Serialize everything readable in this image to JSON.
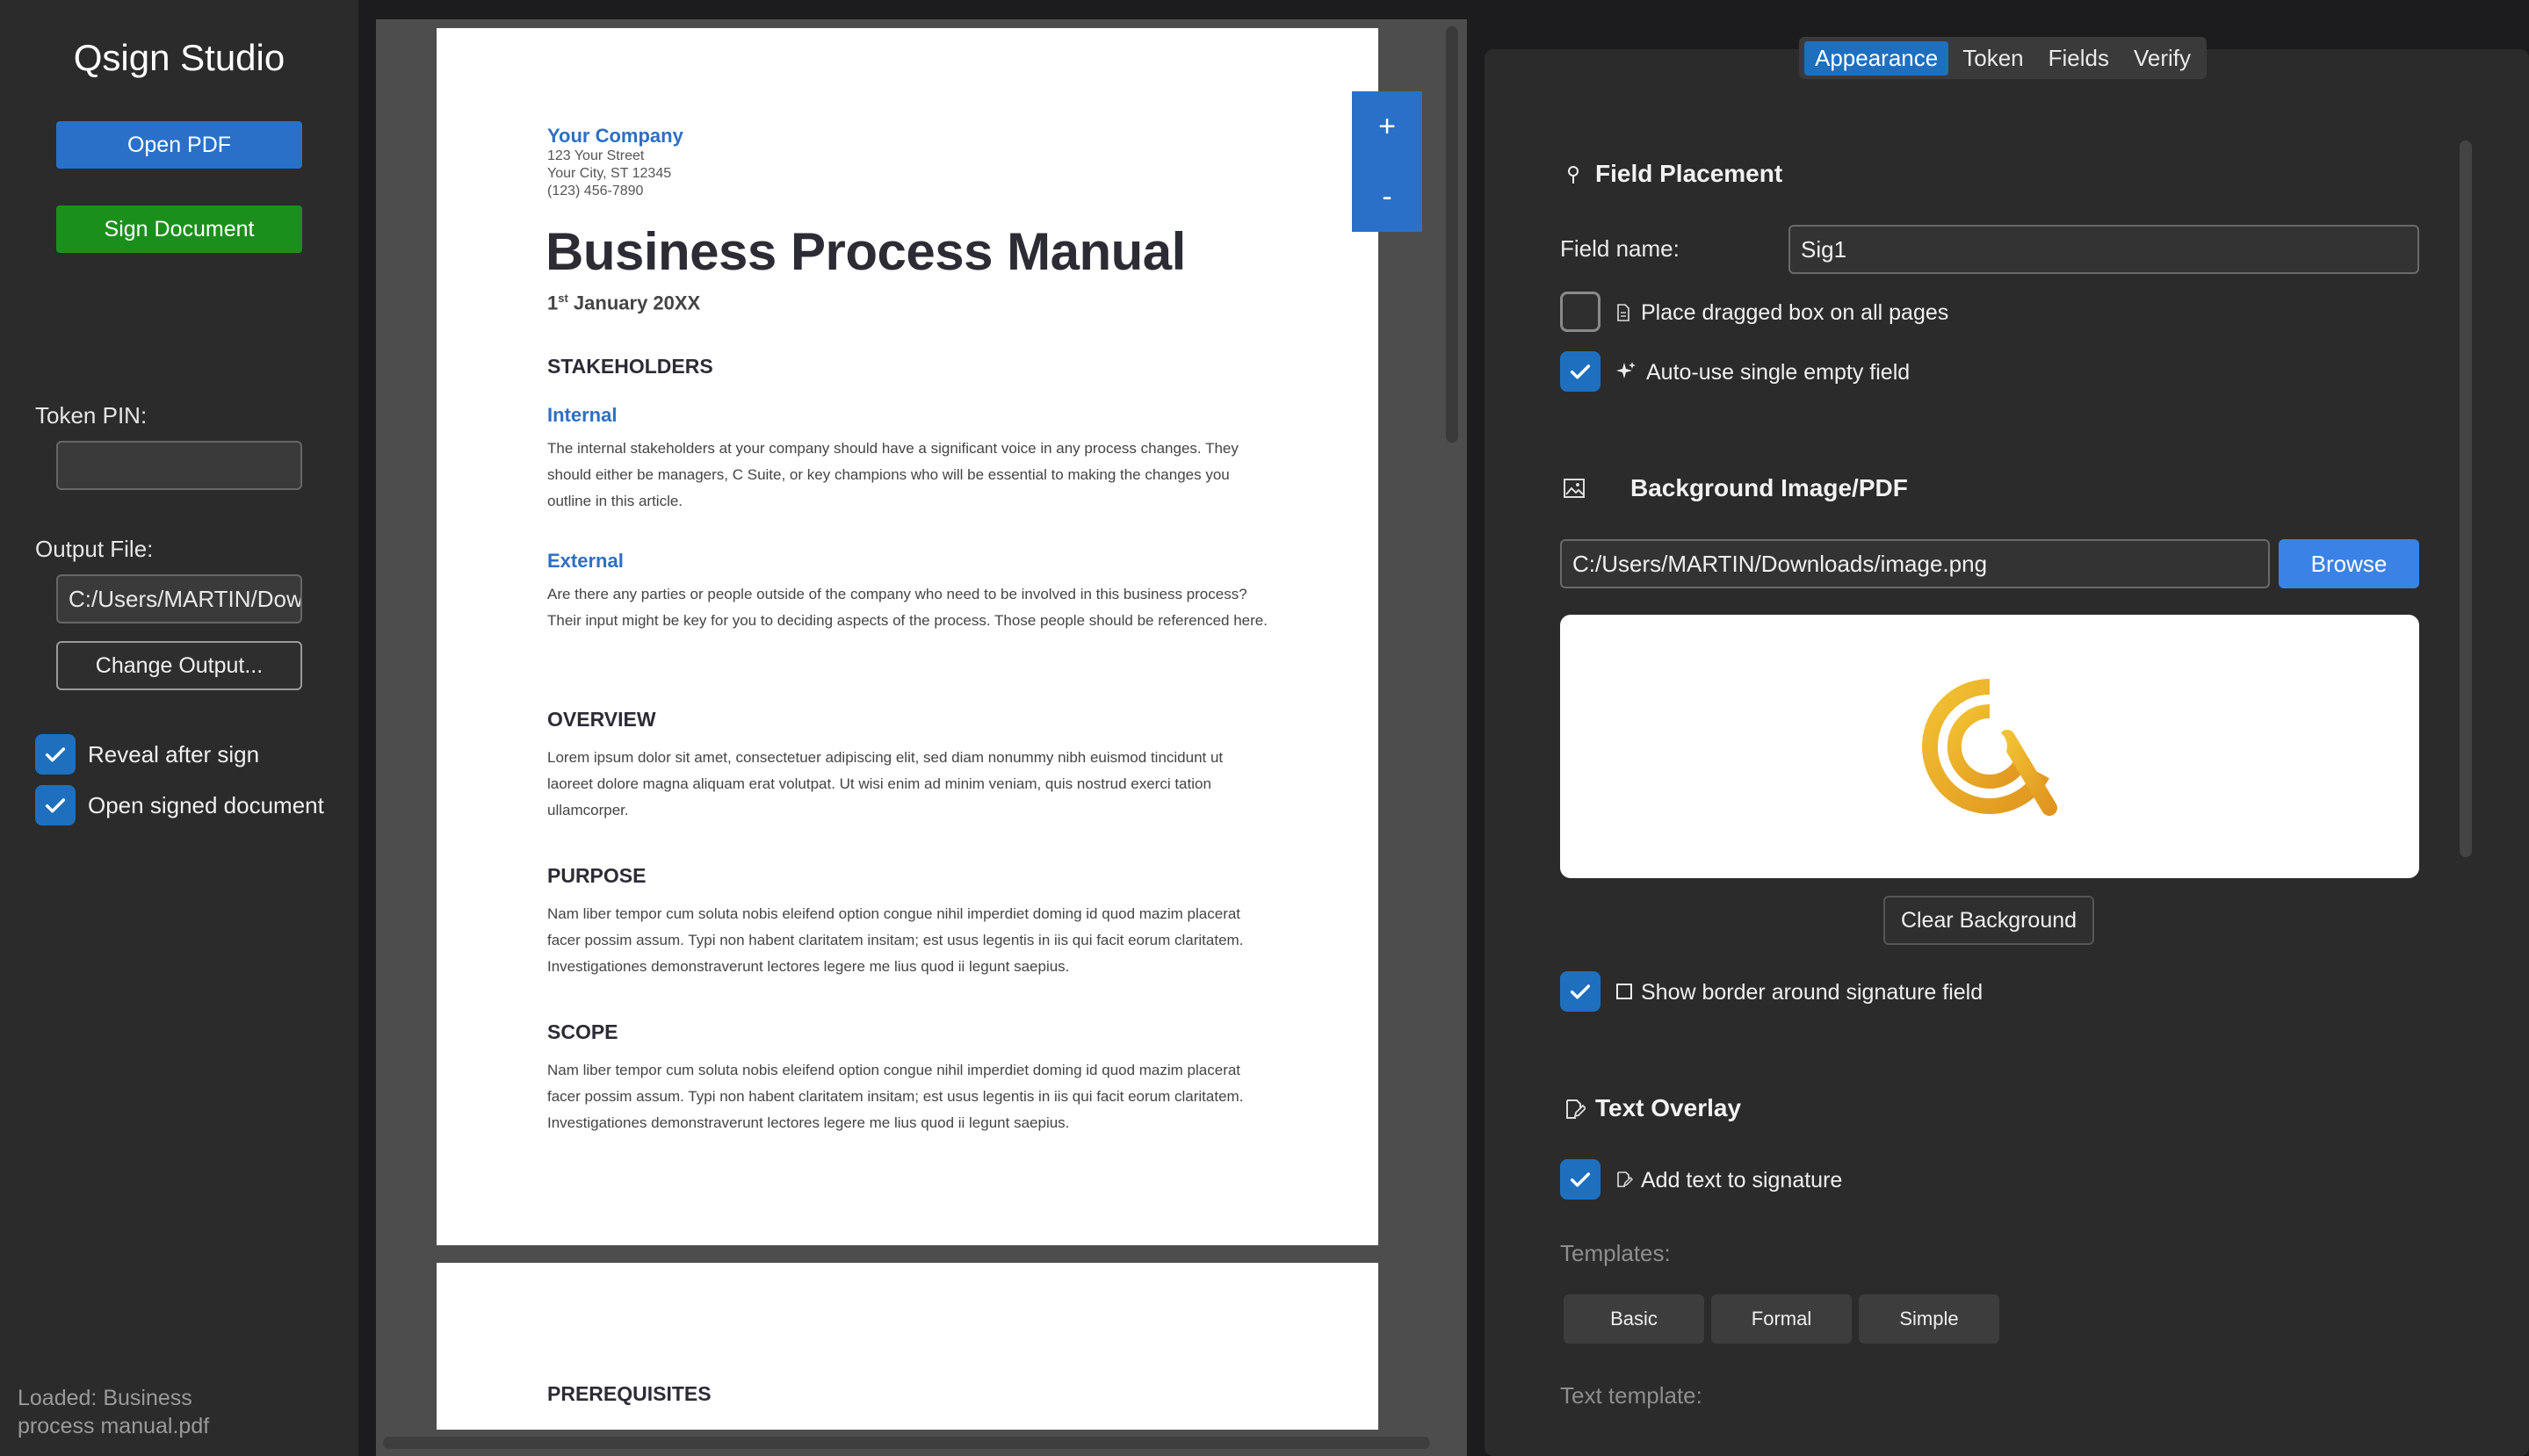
{
  "sidebar": {
    "app_title": "Qsign Studio",
    "open_pdf_label": "Open PDF",
    "sign_document_label": "Sign Document",
    "token_pin_label": "Token PIN:",
    "token_pin_value": "",
    "output_file_label": "Output File:",
    "output_file_value": "C:/Users/MARTIN/Dow",
    "change_output_label": "Change Output...",
    "reveal_after_sign": {
      "label": "Reveal after sign",
      "checked": true
    },
    "open_signed_document": {
      "label": "Open signed document",
      "checked": true
    },
    "status_line1": "Loaded: Business",
    "status_line2": "process manual.pdf"
  },
  "viewer": {
    "zoom_in_label": "+",
    "zoom_out_label": "-",
    "page1": {
      "company": "Your Company",
      "address1": "123 Your Street",
      "address2": "Your City, ST 12345",
      "phone": "(123) 456-7890",
      "title": "Business Process Manual",
      "date_day": "1",
      "date_sup": "st",
      "date_rest": " January 20XX",
      "stakeholders_heading": "STAKEHOLDERS",
      "internal_heading": "Internal",
      "internal_text": "The internal stakeholders at your company should have a significant voice in any process changes. They should either be managers, C Suite, or key champions who will be essential to making the changes you outline in this article.",
      "external_heading": "External",
      "external_text": "Are there any parties or people outside of the company who need to be involved in this business process? Their input might be key for you to deciding aspects of the process. Those people should be referenced here.",
      "overview_heading": "OVERVIEW",
      "overview_text": "Lorem ipsum dolor sit amet, consectetuer adipiscing elit, sed diam nonummy nibh euismod tincidunt ut laoreet dolore magna aliquam erat volutpat. Ut wisi enim ad minim veniam, quis nostrud exerci tation ullamcorper.",
      "purpose_heading": "PURPOSE",
      "purpose_text": "Nam liber tempor cum soluta nobis eleifend option congue nihil imperdiet doming id quod mazim placerat facer possim assum. Typi non habent claritatem insitam; est usus legentis in iis qui facit eorum claritatem. Investigationes demonstraverunt lectores legere me lius quod ii legunt saepius.",
      "scope_heading": "SCOPE",
      "scope_text": "Nam liber tempor cum soluta nobis eleifend option congue nihil imperdiet doming id quod mazim placerat facer possim assum. Typi non habent claritatem insitam; est usus legentis in iis qui facit eorum claritatem. Investigationes demonstraverunt lectores legere me lius quod ii legunt saepius."
    },
    "page2": {
      "prerequisites_heading": "PREREQUISITES"
    }
  },
  "tabs": [
    "Appearance",
    "Token",
    "Fields",
    "Verify"
  ],
  "active_tab": "Appearance",
  "field_placement": {
    "title": "Field Placement",
    "field_name_label": "Field name:",
    "field_name_value": "Sig1",
    "place_all_pages": {
      "label": "Place dragged box on all pages",
      "checked": false
    },
    "auto_use_empty": {
      "label": "Auto-use single empty field",
      "checked": true
    }
  },
  "background": {
    "title": "Background Image/PDF",
    "path_value": "C:/Users/MARTIN/Downloads/image.png",
    "browse_label": "Browse",
    "clear_label": "Clear Background",
    "show_border": {
      "label": "Show border around signature field",
      "checked": true
    }
  },
  "text_overlay": {
    "title": "Text Overlay",
    "add_text": {
      "label": "Add text to signature",
      "checked": true
    },
    "templates_label": "Templates:",
    "templates": [
      "Basic",
      "Formal",
      "Simple"
    ],
    "text_template_label": "Text template:"
  },
  "colors": {
    "accent_blue": "#1f6fbf",
    "sign_green": "#1b8f1b",
    "logo_gold": "#e9a928"
  }
}
